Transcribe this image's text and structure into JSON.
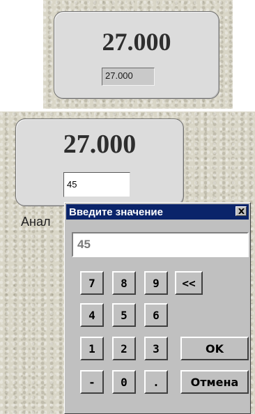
{
  "top_widget": {
    "big_value": "27.000",
    "field_value": "27.000"
  },
  "second_widget": {
    "big_value": "27.000",
    "field_value": "45"
  },
  "partial_label": "Анал",
  "dialog": {
    "title": "Введите значение",
    "close_icon": "close-icon",
    "input_value": "45",
    "keys": {
      "k7": "7",
      "k8": "8",
      "k9": "9",
      "backspace": "<<",
      "k4": "4",
      "k5": "5",
      "k6": "6",
      "k1": "1",
      "k2": "2",
      "k3": "3",
      "ok": "OK",
      "minus": "-",
      "k0": "0",
      "dot": ".",
      "cancel": "Отмена"
    }
  },
  "colors": {
    "titlebar": "#0a246a",
    "dialog_face": "#c0c0c0",
    "panel_face": "#dcdcdc",
    "stone_background": "#d9d6c7"
  }
}
